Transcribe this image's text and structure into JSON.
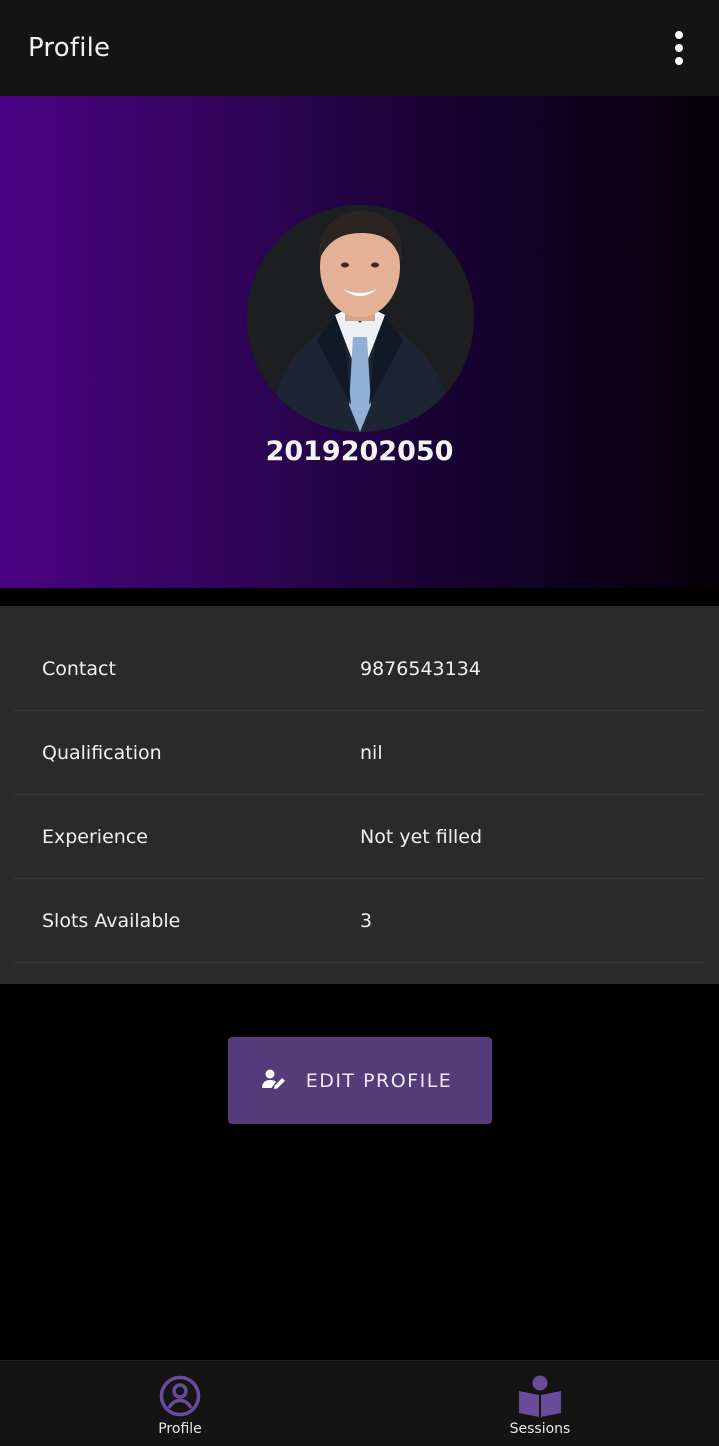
{
  "appbar": {
    "title": "Profile",
    "menu_icon": "more-vert-icon"
  },
  "profile": {
    "user_id": "2019202050",
    "avatar": "profile-photo"
  },
  "details": [
    {
      "label": "Contact",
      "value": "9876543134"
    },
    {
      "label": "Qualification",
      "value": "nil"
    },
    {
      "label": "Experience",
      "value": "Not yet filled"
    },
    {
      "label": "Slots Available",
      "value": "3"
    }
  ],
  "edit_button": {
    "label": "EDIT PROFILE",
    "icon": "edit-person-icon"
  },
  "nav": [
    {
      "label": "Profile",
      "icon": "account-circle-icon"
    },
    {
      "label": "Sessions",
      "icon": "book-reader-icon"
    }
  ],
  "colors": {
    "accent": "#553b7a",
    "nav_icon": "#6a4a9a",
    "hero_start": "#4c0384",
    "hero_end": "#040008"
  }
}
